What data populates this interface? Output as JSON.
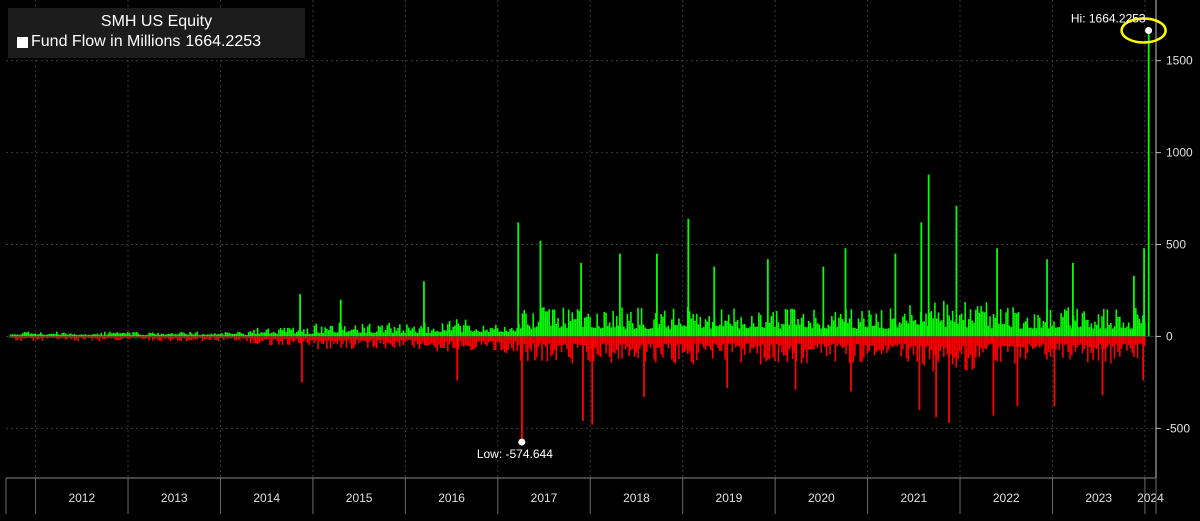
{
  "chart_data": {
    "type": "bar",
    "title": "SMH US Equity",
    "series": [
      {
        "name": "Fund Flow in Millions",
        "last_value": "1664.2253"
      }
    ],
    "positive_color": "#00ff00",
    "negative_color": "#ff0000",
    "x_tick_labels": [
      "2012",
      "2013",
      "2014",
      "2015",
      "2016",
      "2017",
      "2018",
      "2019",
      "2020",
      "2021",
      "2022",
      "2023",
      "2024"
    ],
    "x_range": [
      2011.68,
      2024.12
    ],
    "ylim": [
      -770,
      1830
    ],
    "y_ticks": [
      -500,
      0,
      500,
      1000,
      1500
    ],
    "y_tick_labels": [
      "-500",
      "0",
      "500",
      "1000",
      "1500"
    ],
    "grid": true,
    "legend_position": "top-left",
    "annotations": {
      "high": {
        "label": "Hi: 1664.2253",
        "x": 2024.04,
        "value": 1664.2253
      },
      "low": {
        "label": "Low: -574.644",
        "x": 2017.26,
        "value": -574.644
      }
    },
    "highlight_circle_color": "#ffff00",
    "spikes": {
      "positive": [
        {
          "x": 2014.86,
          "value": 230
        },
        {
          "x": 2015.3,
          "value": 200
        },
        {
          "x": 2016.2,
          "value": 300
        },
        {
          "x": 2017.22,
          "value": 620
        },
        {
          "x": 2017.46,
          "value": 520
        },
        {
          "x": 2017.9,
          "value": 400
        },
        {
          "x": 2018.32,
          "value": 450
        },
        {
          "x": 2018.72,
          "value": 450
        },
        {
          "x": 2019.06,
          "value": 640
        },
        {
          "x": 2019.34,
          "value": 380
        },
        {
          "x": 2019.92,
          "value": 420
        },
        {
          "x": 2020.52,
          "value": 380
        },
        {
          "x": 2020.76,
          "value": 480
        },
        {
          "x": 2021.3,
          "value": 450
        },
        {
          "x": 2021.58,
          "value": 620
        },
        {
          "x": 2021.66,
          "value": 880
        },
        {
          "x": 2021.96,
          "value": 710
        },
        {
          "x": 2022.4,
          "value": 480
        },
        {
          "x": 2022.94,
          "value": 420
        },
        {
          "x": 2023.22,
          "value": 400
        },
        {
          "x": 2023.88,
          "value": 330
        },
        {
          "x": 2023.99,
          "value": 480
        },
        {
          "x": 2024.04,
          "value": 1664.2253
        }
      ],
      "negative": [
        {
          "x": 2014.88,
          "value": -250
        },
        {
          "x": 2016.56,
          "value": -240
        },
        {
          "x": 2017.26,
          "value": -574.644
        },
        {
          "x": 2017.92,
          "value": -460
        },
        {
          "x": 2018.02,
          "value": -480
        },
        {
          "x": 2018.58,
          "value": -330
        },
        {
          "x": 2019.48,
          "value": -280
        },
        {
          "x": 2020.22,
          "value": -290
        },
        {
          "x": 2020.82,
          "value": -300
        },
        {
          "x": 2021.56,
          "value": -400
        },
        {
          "x": 2021.74,
          "value": -440
        },
        {
          "x": 2021.88,
          "value": -470
        },
        {
          "x": 2022.36,
          "value": -430
        },
        {
          "x": 2022.62,
          "value": -380
        },
        {
          "x": 2023.02,
          "value": -380
        },
        {
          "x": 2023.54,
          "value": -320
        },
        {
          "x": 2023.98,
          "value": -240
        }
      ]
    }
  }
}
